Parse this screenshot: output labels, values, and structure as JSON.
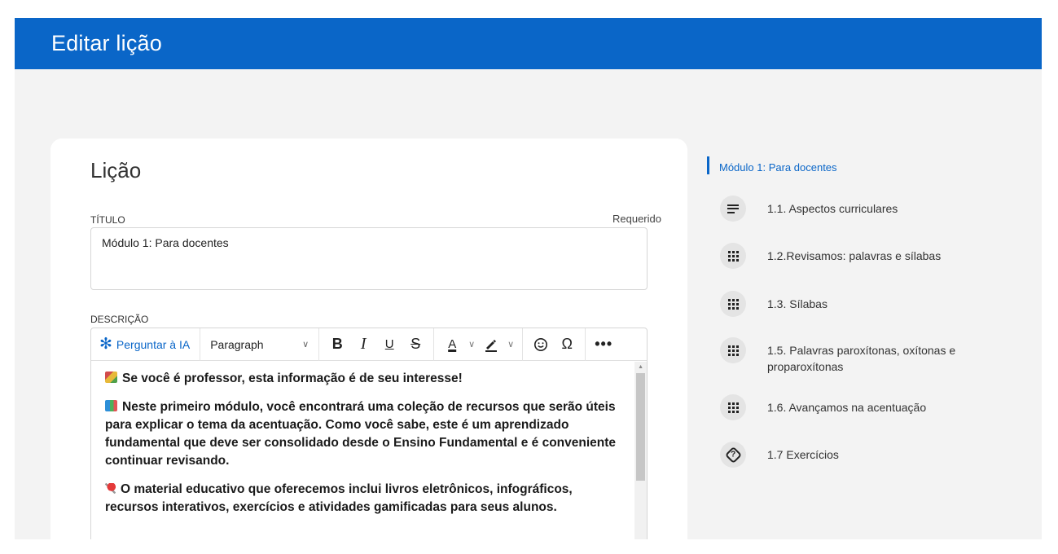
{
  "header": {
    "title": "Editar lição"
  },
  "card": {
    "title": "Lição",
    "title_label": "TÍTULO",
    "required_label": "Requerido",
    "title_value": "Módulo 1: Para docentes",
    "description_label": "DESCRIÇÃO"
  },
  "toolbar": {
    "ask_ai": "Perguntar à IA",
    "format": "Paragraph",
    "bold": "B",
    "italic": "I",
    "underline": "U",
    "strikethrough": "S",
    "text_color": "A",
    "omega": "Ω",
    "more": "•••"
  },
  "description": {
    "paragraphs": [
      "Se você é professor, esta informação é de seu interesse!",
      "Neste primeiro módulo, você encontrará uma coleção de recursos que serão úteis para explicar o tema da acentuação. Como você sabe, este é um aprendizado fundamental que deve ser consolidado desde o Ensino Fundamental e é conveniente continuar revisando.",
      "O material educativo que oferecemos inclui livros eletrônicos, infográficos, recursos interativos, exercícios e atividades gamificadas para seus alunos."
    ]
  },
  "sidebar": {
    "active": "Módulo 1: Para docentes",
    "items": [
      {
        "label": "1.1. Aspectos curriculares",
        "icon": "text-lines-icon"
      },
      {
        "label": "1.2.Revisamos: palavras e sílabas",
        "icon": "grid-icon"
      },
      {
        "label": "1.3. Sílabas",
        "icon": "grid-icon"
      },
      {
        "label": "1.5. Palavras paroxítonas, oxítonas e proparoxítonas",
        "icon": "grid-icon"
      },
      {
        "label": "1.6. Avançamos na acentuação",
        "icon": "grid-icon"
      },
      {
        "label": "1.7 Exercícios",
        "icon": "quiz-icon"
      }
    ]
  }
}
